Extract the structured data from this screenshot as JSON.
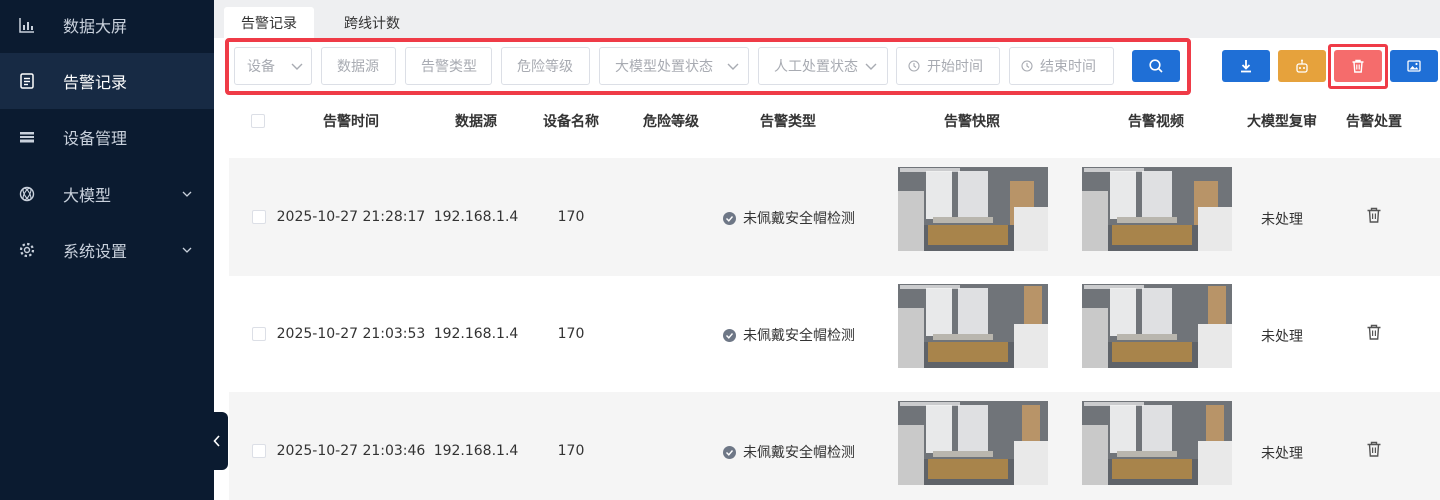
{
  "sidebar": {
    "items": [
      {
        "label": "数据大屏",
        "icon": "bar-chart-icon"
      },
      {
        "label": "告警记录",
        "icon": "document-icon"
      },
      {
        "label": "设备管理",
        "icon": "device-stack-icon"
      },
      {
        "label": "大模型",
        "icon": "ai-model-icon"
      },
      {
        "label": "系统设置",
        "icon": "gear-icon"
      }
    ]
  },
  "tabs": [
    "告警记录",
    "跨线计数"
  ],
  "filters": {
    "device": "设备",
    "source": "数据源",
    "alert_type": "告警类型",
    "danger_level": "危险等级",
    "llm_status": "大模型处置状态",
    "manual_status": "人工处置状态",
    "start_time": "开始时间",
    "end_time": "结束时间"
  },
  "toolbar": {
    "search_icon": "search-icon",
    "download_icon": "download-icon",
    "robot_icon": "robot-icon",
    "delete_icon": "trash-icon",
    "image_icon": "image-icon"
  },
  "table": {
    "headers": [
      "告警时间",
      "数据源",
      "设备名称",
      "危险等级",
      "告警类型",
      "告警快照",
      "告警视频",
      "大模型复审",
      "告警处置"
    ],
    "rows": [
      {
        "time": "2025-10-27 21:28:17",
        "source": "192.168.1.4",
        "device": "170",
        "level": "",
        "type": "未佩戴安全帽检测",
        "review": "未处理"
      },
      {
        "time": "2025-10-27 21:03:53",
        "source": "192.168.1.4",
        "device": "170",
        "level": "",
        "type": "未佩戴安全帽检测",
        "review": "未处理"
      },
      {
        "time": "2025-10-27 21:03:46",
        "source": "192.168.1.4",
        "device": "170",
        "level": "",
        "type": "未佩戴安全帽检测",
        "review": "未处理"
      }
    ]
  },
  "colors": {
    "sidebar_bg": "#0b1b30",
    "primary": "#1f6fd6",
    "warning": "#e6a23c",
    "danger": "#f56c6c",
    "highlight": "#ef3b47"
  }
}
